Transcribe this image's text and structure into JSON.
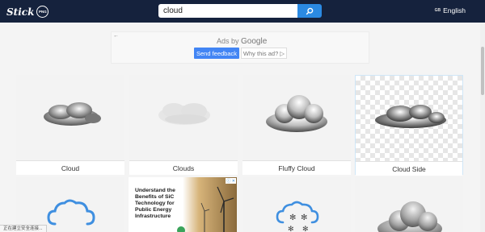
{
  "header": {
    "logo_text": "Stick",
    "logo_badge": "PNG",
    "search_value": "cloud",
    "language_flag": "GB",
    "language_label": "English"
  },
  "ad": {
    "back_glyph": "←",
    "ads_by": "Ads by",
    "ads_brand": "Google",
    "feedback_label": "Send feedback",
    "why_label": "Why this ad?",
    "why_icon": "▷"
  },
  "results": [
    {
      "caption": "Cloud"
    },
    {
      "caption": "Clouds"
    },
    {
      "caption": "Fluffy Cloud"
    },
    {
      "caption": "Cloud Side"
    }
  ],
  "promo": {
    "text": "Understand the Benefits of SiC Technology for Public Energy Infrastructure",
    "badge": "ⓘ ✕"
  },
  "status_text": "正在建立安全连接..."
}
